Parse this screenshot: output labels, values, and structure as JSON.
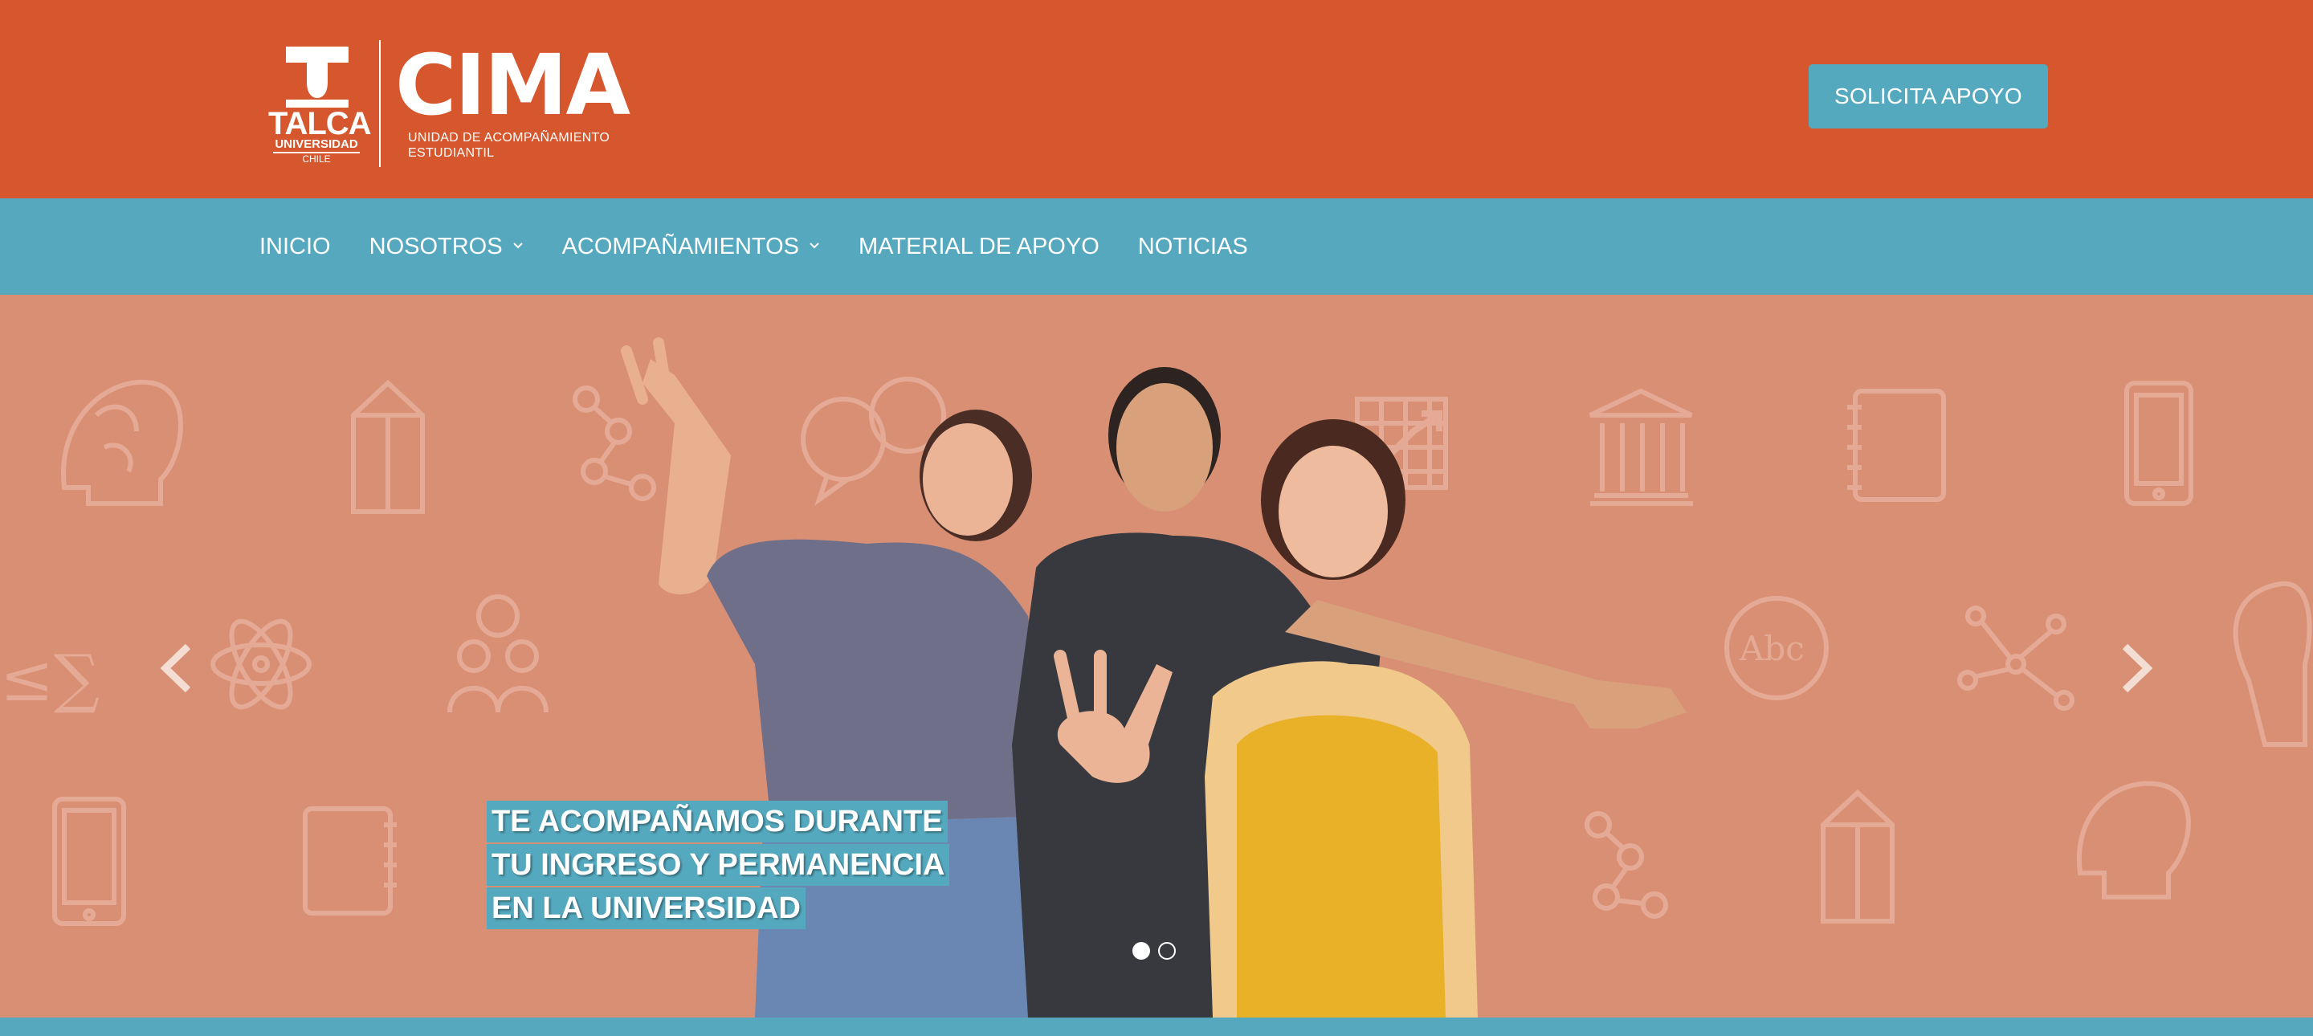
{
  "header": {
    "university": {
      "name": "TALCA",
      "line2": "UNIVERSIDAD",
      "line3": "CHILE"
    },
    "brand": {
      "name": "CIMA",
      "subtitle_line1": "UNIDAD DE ACOMPAÑAMIENTO",
      "subtitle_line2": "ESTUDIANTIL"
    },
    "cta_label": "SOLICITA APOYO"
  },
  "nav": {
    "items": [
      {
        "label": "INICIO",
        "dropdown": false
      },
      {
        "label": "NOSOTROS",
        "dropdown": true
      },
      {
        "label": "ACOMPAÑAMIENTOS",
        "dropdown": true
      },
      {
        "label": "MATERIAL DE APOYO",
        "dropdown": false
      },
      {
        "label": "NOTICIAS",
        "dropdown": false
      }
    ]
  },
  "hero": {
    "caption_lines": [
      "TE ACOMPAÑAMOS DURANTE",
      "TU INGRESO Y PERMANENCIA",
      "EN LA UNIVERSIDAD"
    ],
    "slides": 2,
    "active_slide": 1,
    "image_description_icon": "students-photo"
  },
  "colors": {
    "header_bg": "#d6572d",
    "nav_bg": "#56a8be",
    "hero_bg": "#d98f74",
    "accent": "#55a9bf"
  }
}
